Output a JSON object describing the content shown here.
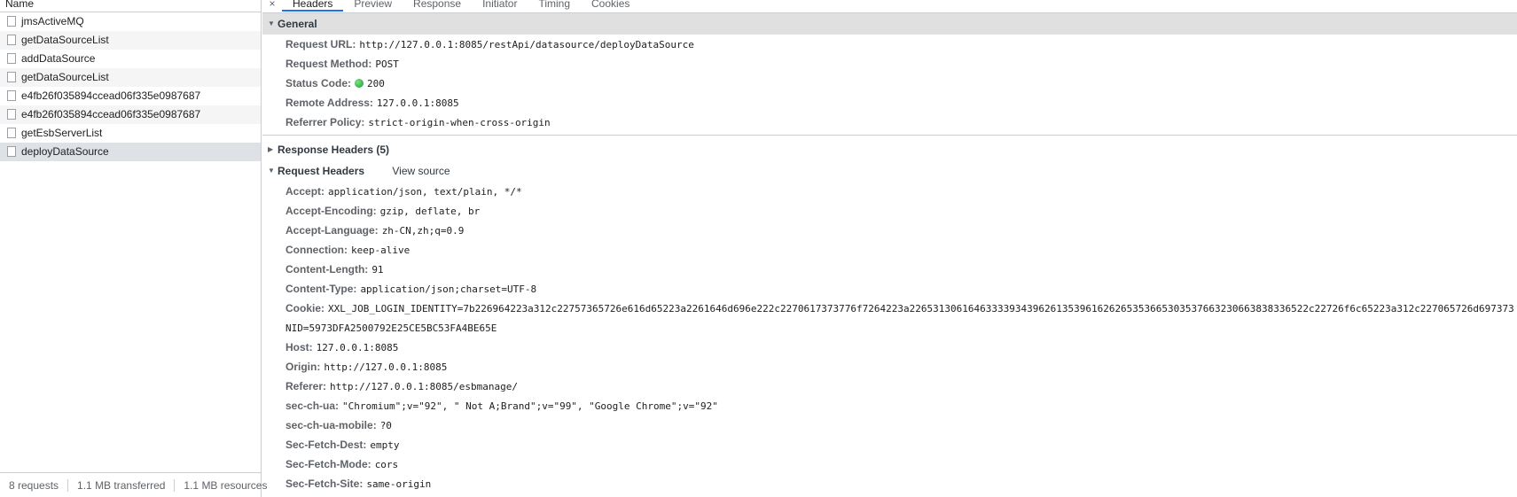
{
  "requests": {
    "header": "Name",
    "items": [
      "jmsActiveMQ",
      "getDataSourceList",
      "addDataSource",
      "getDataSourceList",
      "e4fb26f035894ccead06f335e0987687",
      "e4fb26f035894ccead06f335e0987687",
      "getEsbServerList",
      "deployDataSource"
    ],
    "selected_index": 7,
    "status": {
      "requests": "8 requests",
      "transferred": "1.1 MB transferred",
      "resources": "1.1 MB resources"
    }
  },
  "tabs": {
    "close": "×",
    "items": [
      "Headers",
      "Preview",
      "Response",
      "Initiator",
      "Timing",
      "Cookies"
    ],
    "active": "Headers"
  },
  "general": {
    "title": "General",
    "rows": [
      {
        "k": "Request URL:",
        "v": "http://127.0.0.1:8085/restApi/datasource/deployDataSource"
      },
      {
        "k": "Request Method:",
        "v": "POST"
      },
      {
        "k": "Status Code:",
        "v": "200"
      },
      {
        "k": "Remote Address:",
        "v": "127.0.0.1:8085"
      },
      {
        "k": "Referrer Policy:",
        "v": "strict-origin-when-cross-origin"
      }
    ]
  },
  "response_headers": {
    "title": "Response Headers (5)"
  },
  "request_headers": {
    "title": "Request Headers",
    "view_source": "View source",
    "rows": [
      {
        "k": "Accept:",
        "v": "application/json, text/plain, */*"
      },
      {
        "k": "Accept-Encoding:",
        "v": "gzip, deflate, br"
      },
      {
        "k": "Accept-Language:",
        "v": "zh-CN,zh;q=0.9"
      },
      {
        "k": "Connection:",
        "v": "keep-alive"
      },
      {
        "k": "Content-Length:",
        "v": "91"
      },
      {
        "k": "Content-Type:",
        "v": "application/json;charset=UTF-8"
      },
      {
        "k": "Cookie:",
        "v": "XXL_JOB_LOGIN_IDENTITY=7b226964223a312c22757365726e616d65223a2261646d696e222c2270617373776f7264223a22653130616463333934396261353961626265353665303537663230663838336522c22726f6c65223a312c227065726d697373"
      },
      {
        "k": "",
        "v": "NID=5973DFA2500792E25CE5BC53FA4BE65E"
      },
      {
        "k": "Host:",
        "v": "127.0.0.1:8085"
      },
      {
        "k": "Origin:",
        "v": "http://127.0.0.1:8085"
      },
      {
        "k": "Referer:",
        "v": "http://127.0.0.1:8085/esbmanage/"
      },
      {
        "k": "sec-ch-ua:",
        "v": "\"Chromium\";v=\"92\", \" Not A;Brand\";v=\"99\", \"Google Chrome\";v=\"92\""
      },
      {
        "k": "sec-ch-ua-mobile:",
        "v": "?0"
      },
      {
        "k": "Sec-Fetch-Dest:",
        "v": "empty"
      },
      {
        "k": "Sec-Fetch-Mode:",
        "v": "cors"
      },
      {
        "k": "Sec-Fetch-Site:",
        "v": "same-origin"
      }
    ]
  },
  "colors": {
    "accent": "#1a73e8",
    "status_ok": "#0f9d3c",
    "selected_row": "#dee1e6"
  },
  "icons": {
    "caret_down": "▼",
    "caret_right": "▶",
    "file": "file-icon",
    "status": "status-dot-icon"
  }
}
